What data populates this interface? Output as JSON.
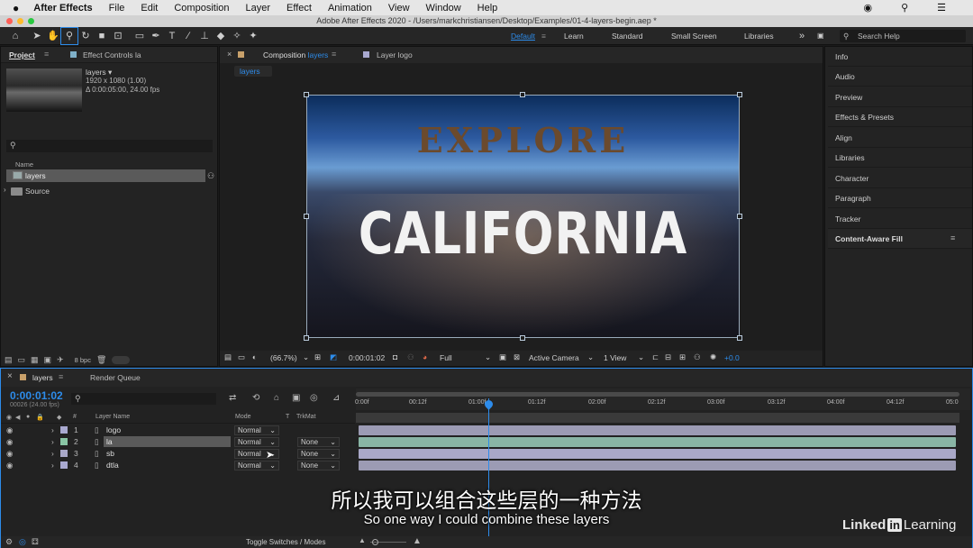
{
  "menubar": {
    "apple": "",
    "app": "After Effects",
    "items": [
      "File",
      "Edit",
      "Composition",
      "Layer",
      "Effect",
      "Animation",
      "View",
      "Window",
      "Help"
    ]
  },
  "titlebar": {
    "text": "Adobe After Effects 2020 - /Users/markchristiansen/Desktop/Examples/01-4-layers-begin.aep *"
  },
  "workspaces": {
    "items": [
      "Default",
      "Learn",
      "Standard",
      "Small Screen",
      "Libraries"
    ],
    "more": "»",
    "search": "Search Help"
  },
  "project": {
    "tab": "Project",
    "effects_tab": "Effect Controls la",
    "item_name": "layers ▾",
    "item_dims": "1920 x 1080 (1.00)",
    "item_dur": "Δ 0:00:05:00, 24.00 fps",
    "col_name": "Name",
    "items": [
      {
        "label": "layers"
      },
      {
        "label": "Source"
      }
    ],
    "bpc": "8 bpc"
  },
  "comp": {
    "tab_comp": "Composition",
    "tab_comp_name": "layers",
    "tab_layer": "Layer logo",
    "subtab": "layers",
    "headline1": "EXPLORE",
    "headline2": "CALIFORNIA",
    "zoom": "(66.7%)",
    "timecode": "0:00:01:02",
    "resolution": "Full",
    "camera": "Active Camera",
    "view": "1 View",
    "exposure": "+0.0"
  },
  "right_panels": {
    "items": [
      "Info",
      "Audio",
      "Preview",
      "Effects & Presets",
      "Align",
      "Libraries",
      "Character",
      "Paragraph",
      "Tracker",
      "Content-Aware Fill"
    ]
  },
  "timeline": {
    "tab": "layers",
    "render_queue": "Render Queue",
    "timecode": "0:00:01:02",
    "frames": "00026 (24.00 fps)",
    "col_hash": "#",
    "col_layer": "Layer Name",
    "col_mode": "Mode",
    "col_t": "T",
    "col_trkmat": "TrkMat",
    "ruler": [
      "0:00f",
      "00:12f",
      "01:00f",
      "01:12f",
      "02:00f",
      "02:12f",
      "03:00f",
      "03:12f",
      "04:00f",
      "04:12f",
      "05:0"
    ],
    "layers": [
      {
        "num": "1",
        "name": "logo",
        "mode": "Normal",
        "trkmat": ""
      },
      {
        "num": "2",
        "name": "la",
        "mode": "Normal",
        "trkmat": "None"
      },
      {
        "num": "3",
        "name": "sb",
        "mode": "Normal",
        "trkmat": "None"
      },
      {
        "num": "4",
        "name": "dtla",
        "mode": "Normal",
        "trkmat": "None"
      }
    ],
    "toggle": "Toggle Switches / Modes"
  },
  "subtitle": {
    "zh": "所以我可以组合这些层的一种方法",
    "en": "So one way I could combine these layers"
  },
  "brand": {
    "linked": "Linked",
    "in": "in",
    "learning": "Learning"
  },
  "colors": {
    "accent": "#2d8ceb",
    "layer_label": "#a9a9d0",
    "bar_logo": "#9c9bb4",
    "bar_la": "#89b5a5",
    "bar_sb": "#a9a8c8",
    "bar_dtla": "#9c9bb4"
  }
}
